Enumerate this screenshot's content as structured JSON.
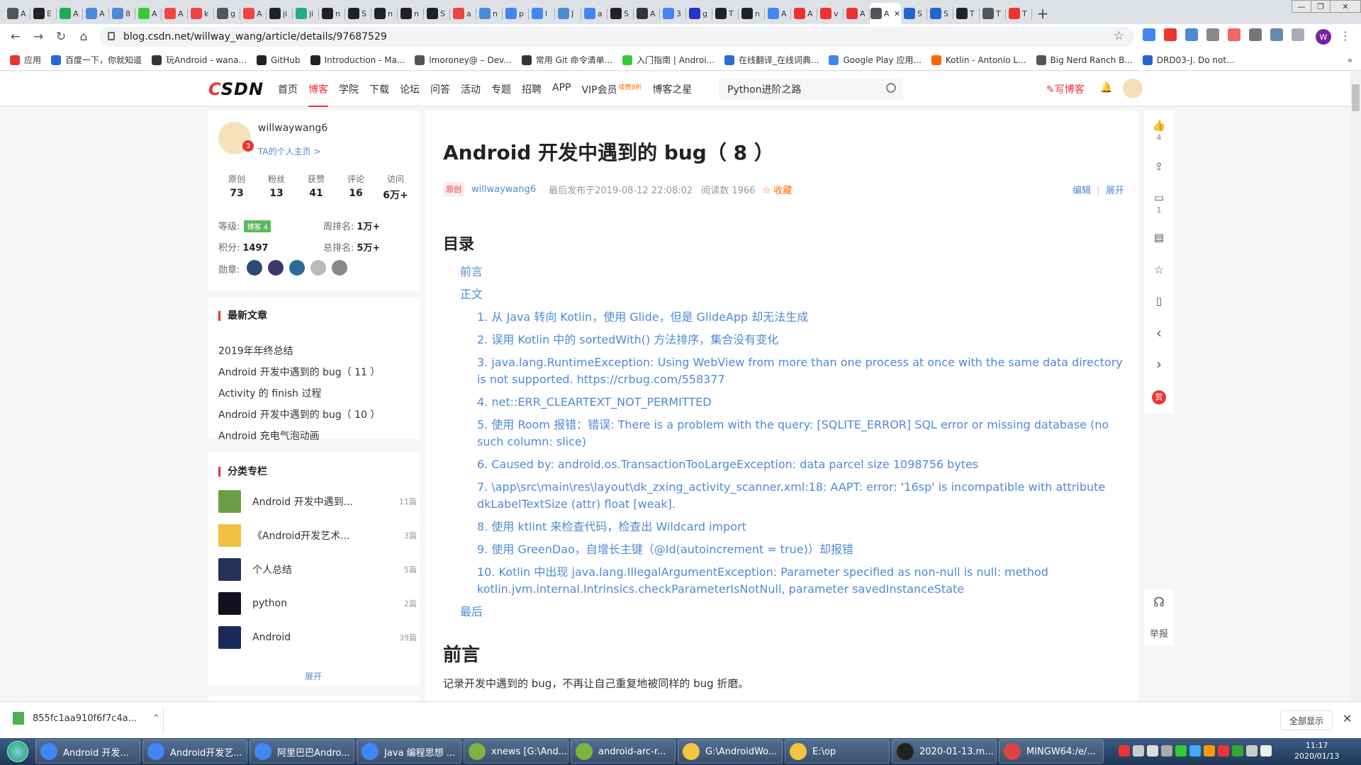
{
  "browser": {
    "tabs": [
      {
        "label": "A",
        "color": "#555"
      },
      {
        "label": "E",
        "color": "#222"
      },
      {
        "label": "A",
        "color": "#2a5"
      },
      {
        "label": "A",
        "color": "#4d8ad6"
      },
      {
        "label": "8",
        "color": "#4d8ad6"
      },
      {
        "label": "A",
        "color": "#3c3"
      },
      {
        "label": "A",
        "color": "#e44"
      },
      {
        "label": "k",
        "color": "#e44"
      },
      {
        "label": "g",
        "color": "#555"
      },
      {
        "label": "A",
        "color": "#e44"
      },
      {
        "label": "ji",
        "color": "#222"
      },
      {
        "label": "ji",
        "color": "#2a8"
      },
      {
        "label": "n",
        "color": "#222"
      },
      {
        "label": "S",
        "color": "#222"
      },
      {
        "label": "n",
        "color": "#222"
      },
      {
        "label": "n",
        "color": "#222"
      },
      {
        "label": "S",
        "color": "#222"
      },
      {
        "label": "a",
        "color": "#e44"
      },
      {
        "label": "n",
        "color": "#4d8ad6"
      },
      {
        "label": "p",
        "color": "#4285f4"
      },
      {
        "label": "l",
        "color": "#4285f4"
      },
      {
        "label": "J",
        "color": "#4d8ad6"
      },
      {
        "label": "a",
        "color": "#4285f4"
      },
      {
        "label": "S",
        "color": "#222"
      },
      {
        "label": "A",
        "color": "#333"
      },
      {
        "label": "3",
        "color": "#4285f4"
      },
      {
        "label": "g",
        "color": "#23c"
      },
      {
        "label": "T",
        "color": "#222"
      },
      {
        "label": "n",
        "color": "#222"
      },
      {
        "label": "A",
        "color": "#4285f4"
      },
      {
        "label": "A",
        "color": "#e33"
      },
      {
        "label": "v",
        "color": "#e33"
      },
      {
        "label": "A",
        "color": "#e33"
      },
      {
        "label": "A",
        "color": "#555",
        "active": true
      },
      {
        "label": "S",
        "color": "#26c"
      },
      {
        "label": "S",
        "color": "#26c"
      },
      {
        "label": "T",
        "color": "#222"
      },
      {
        "label": "T",
        "color": "#555"
      },
      {
        "label": "T",
        "color": "#e33"
      }
    ],
    "active_tab_close": "✕",
    "new_tab": "+",
    "url": "blog.csdn.net/willway_wang/article/details/97687529",
    "profile_initial": "W",
    "bookmarks": [
      "应用",
      "百度一下，你就知道",
      "玩Android - wana...",
      "GitHub",
      "Introduction - Ma...",
      "lmoroney@ – Dev...",
      "常用 Git 命令清单...",
      "入门指南 | Androi...",
      "在线翻译_在线词典...",
      "Google Play 应用...",
      "Kotlin - Antonio L...",
      "Big Nerd Ranch B...",
      "DRD03-J. Do not..."
    ],
    "bookmarks_more": "»"
  },
  "header": {
    "logo_c": "C",
    "logo_rest": "SDN",
    "nav": [
      "首页",
      "博客",
      "学院",
      "下载",
      "论坛",
      "问答",
      "活动",
      "专题",
      "招聘",
      "APP",
      "VIP会员"
    ],
    "vip_badge": "续费8折",
    "star_link": "博客之星",
    "search_value": "Python进阶之路",
    "write_label": "写博客"
  },
  "profile": {
    "name": "willwaywang6",
    "home_link": "TA的个人主页 >",
    "stats": [
      {
        "label": "原创",
        "value": "73"
      },
      {
        "label": "粉丝",
        "value": "13"
      },
      {
        "label": "获赞",
        "value": "41"
      },
      {
        "label": "评论",
        "value": "16"
      },
      {
        "label": "访问",
        "value": "6万+"
      }
    ],
    "level_label": "等级:",
    "level_badge": "博客 4",
    "week_rank_label": "周排名:",
    "week_rank": "1万+",
    "points_label": "积分:",
    "points": "1497",
    "total_rank_label": "总排名:",
    "total_rank": "5万+",
    "medals_label": "勋章:"
  },
  "recent": {
    "title": "最新文章",
    "items": [
      "2019年年终总结",
      "Android 开发中遇到的 bug（ 11 ）",
      "Activity 的 finish 过程",
      "Android 开发中遇到的 bug（ 10 ）",
      "Android 充电气泡动画"
    ]
  },
  "categories": {
    "title": "分类专栏",
    "items": [
      {
        "name": "Android 开发中遇到...",
        "count": "11篇"
      },
      {
        "name": "《Android开发艺术...",
        "count": "3篇"
      },
      {
        "name": "个人总结",
        "count": "5篇"
      },
      {
        "name": "python",
        "count": "2篇"
      },
      {
        "name": "Android",
        "count": "39篇"
      }
    ],
    "expand": "展开"
  },
  "article": {
    "title": "Android 开发中遇到的 bug（ 8 ）",
    "original_badge": "原创",
    "author": "willwaywang6",
    "published": "最后发布于2019-08-12 22:08:02",
    "reads": "阅读数 1966",
    "favorite": "☆ 收藏",
    "edit": "编辑",
    "expand": "展开",
    "toc_title": "目录",
    "toc": [
      {
        "text": "前言",
        "level": 1
      },
      {
        "text": "正文",
        "level": 1
      },
      {
        "text": "1. 从 Java 转向 Kotlin，使用 Glide，但是 GlideApp 却无法生成",
        "level": 2
      },
      {
        "text": "2. 误用 Kotlin 中的 sortedWith() 方法排序，集合没有变化",
        "level": 2
      },
      {
        "text": "3. java.lang.RuntimeException: Using WebView from more than one process at once with the same data directory is not supported. https://crbug.com/558377",
        "level": 2
      },
      {
        "text": "4. net::ERR_CLEARTEXT_NOT_PERMITTED",
        "level": 2
      },
      {
        "text": "5. 使用 Room 报错：错误: There is a problem with the query: [SQLITE_ERROR] SQL error or missing database (no such column: slice)",
        "level": 2
      },
      {
        "text": "6. Caused by: android.os.TransactionTooLargeException: data parcel size 1098756 bytes",
        "level": 2
      },
      {
        "text": "7. \\app\\src\\main\\res\\layout\\dk_zxing_activity_scanner.xml:18: AAPT: error: '16sp' is incompatible with attribute dkLabelTextSize (attr) float [weak].",
        "level": 2
      },
      {
        "text": "8. 使用 ktlint 来检查代码，检查出 Wildcard import",
        "level": 2
      },
      {
        "text": "9. 使用 GreenDao，自增长主键（@Id(autoincrement = true)）却报错",
        "level": 2
      },
      {
        "text": "10. Kotlin 中出现 java.lang.IllegalArgumentException: Parameter specified as non-null is null: method kotlin.jvm.internal.Intrinsics.checkParameterIsNotNull, parameter savedInstanceState",
        "level": 2
      },
      {
        "text": "最后",
        "level": 1
      }
    ],
    "preface_title": "前言",
    "preface_text": "记录开发中遇到的 bug，不再让自己重复地被同样的 bug 折磨。"
  },
  "sidebar_right": {
    "like_count": "4",
    "comment_count": "1",
    "reward": "赏",
    "report": "举报"
  },
  "download": {
    "file": "855fc1aa910f6f7c4a...",
    "show_all": "全部显示"
  },
  "taskbar": {
    "items": [
      {
        "label": "Android 开发...",
        "color": "#4285f4"
      },
      {
        "label": "Android开发艺...",
        "color": "#4285f4"
      },
      {
        "label": "阿里巴巴Andro...",
        "color": "#4285f4"
      },
      {
        "label": "Java 编程思想 ...",
        "color": "#4285f4"
      },
      {
        "label": "xnews [G:\\And...",
        "color": "#7cb342"
      },
      {
        "label": "android-arc-r...",
        "color": "#7cb342"
      },
      {
        "label": "G:\\AndroidWo...",
        "color": "#f4c542"
      },
      {
        "label": "E:\\op",
        "color": "#f4c542"
      },
      {
        "label": "2020-01-13.m...",
        "color": "#222"
      },
      {
        "label": "MINGW64:/e/...",
        "color": "#d44"
      }
    ],
    "time": "11:17",
    "date": "2020/01/13"
  }
}
